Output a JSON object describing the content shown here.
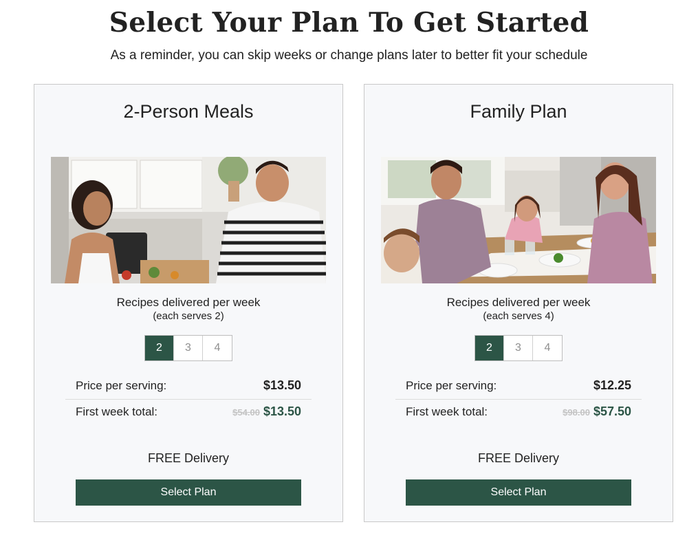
{
  "header": {
    "title": "Select Your Plan To Get Started",
    "subtitle": "As a reminder, you can skip weeks or change plans later to better fit your schedule"
  },
  "plans": [
    {
      "name": "2-Person Meals",
      "image": "couple-in-kitchen-photo",
      "recipes_label": "Recipes delivered per week",
      "serves_label": "(each serves 2)",
      "recipe_options": [
        "2",
        "3",
        "4"
      ],
      "selected_recipes": "2",
      "price_per_serving_label": "Price per serving:",
      "price_per_serving": "$13.50",
      "first_week_label": "First week total:",
      "first_week_original": "$54.00",
      "first_week_total": "$13.50",
      "delivery": "FREE Delivery",
      "button_label": "Select Plan"
    },
    {
      "name": "Family Plan",
      "image": "family-dinner-photo",
      "recipes_label": "Recipes delivered per week",
      "serves_label": "(each serves 4)",
      "recipe_options": [
        "2",
        "3",
        "4"
      ],
      "selected_recipes": "2",
      "price_per_serving_label": "Price per serving:",
      "price_per_serving": "$12.25",
      "first_week_label": "First week total:",
      "first_week_original": "$98.00",
      "first_week_total": "$57.50",
      "delivery": "FREE Delivery",
      "button_label": "Select Plan"
    }
  ],
  "colors": {
    "accent": "#2c5546",
    "card_background": "#f7f8fa",
    "card_border": "#c8c8c8",
    "strikethrough": "#c4c4c4"
  }
}
